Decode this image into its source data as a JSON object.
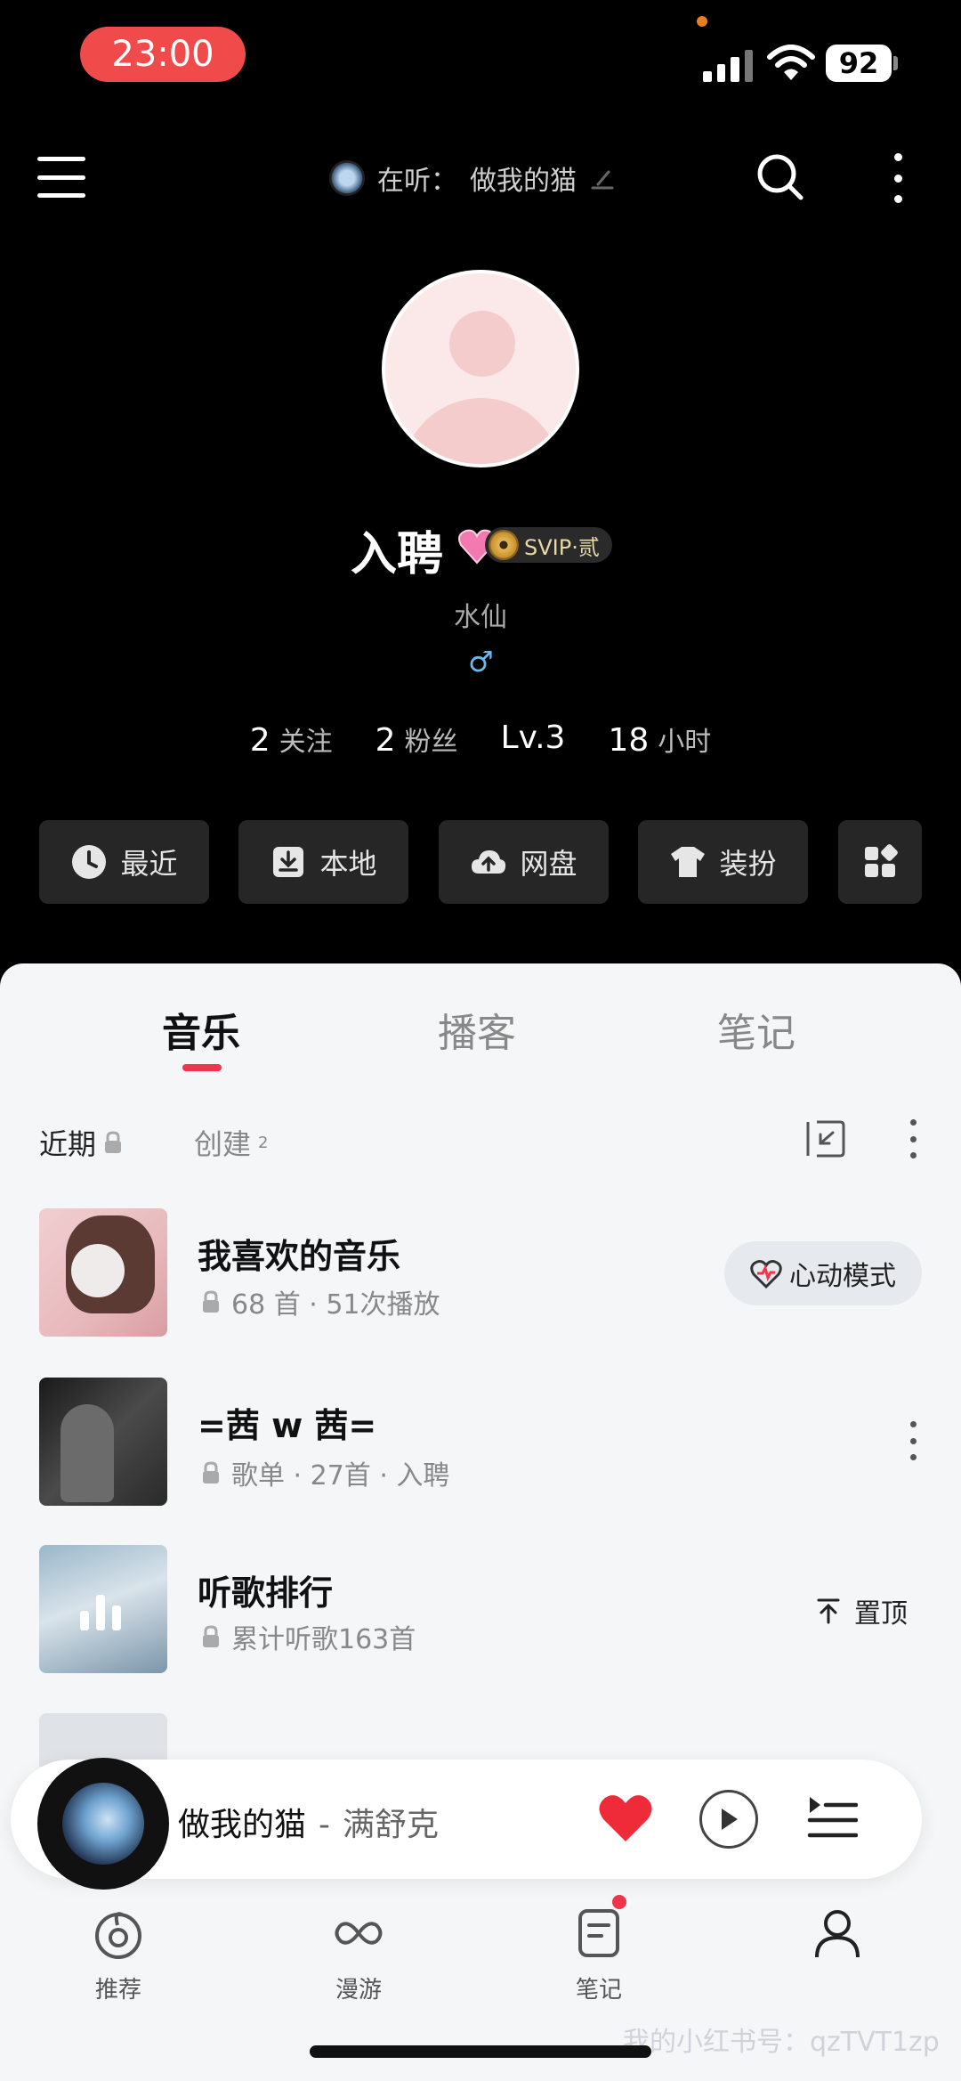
{
  "status_bar": {
    "time": "23:00",
    "battery": "92"
  },
  "header": {
    "now_playing_label": "在听：",
    "now_playing_song": "做我的猫"
  },
  "profile": {
    "name": "入聘",
    "vip_label": "SVIP·贰",
    "signature": "水仙",
    "gender_symbol": "♂",
    "stats": [
      {
        "value": "2",
        "label": "关注"
      },
      {
        "value": "2",
        "label": "粉丝"
      },
      {
        "value": "Lv.3",
        "label": ""
      },
      {
        "value": "18",
        "label": "小时"
      }
    ]
  },
  "shortcuts": [
    {
      "label": "最近",
      "icon": "clock-icon"
    },
    {
      "label": "本地",
      "icon": "download-icon"
    },
    {
      "label": "网盘",
      "icon": "cloud-upload-icon"
    },
    {
      "label": "装扮",
      "icon": "shirt-icon"
    },
    {
      "label": "",
      "icon": "grid-icon"
    }
  ],
  "tabs": [
    "音乐",
    "播客",
    "笔记"
  ],
  "filters": {
    "recent": "近期",
    "created": "创建",
    "created_count": "2"
  },
  "playlists": [
    {
      "title": "我喜欢的音乐",
      "meta": "68 首 · 51次播放",
      "action": "心动模式"
    },
    {
      "title": "=茜 w 茜=",
      "meta": "歌单 · 27首 · 入聘"
    },
    {
      "title": "听歌排行",
      "meta": "累计听歌163首",
      "action": "置顶"
    }
  ],
  "player": {
    "title": "做我的猫",
    "separator": "-",
    "artist": "满舒克"
  },
  "nav": [
    {
      "label": "推荐",
      "icon": "netease-logo-icon"
    },
    {
      "label": "漫游",
      "icon": "infinity-icon"
    },
    {
      "label": "笔记",
      "icon": "note-icon"
    },
    {
      "label": "",
      "icon": "person-icon"
    }
  ],
  "watermark": "我的小红书号：qzTVT1zp",
  "colors": {
    "accent": "#f0344b",
    "status_pill": "#f04a4a",
    "sheet_bg": "#f4f6f8"
  }
}
